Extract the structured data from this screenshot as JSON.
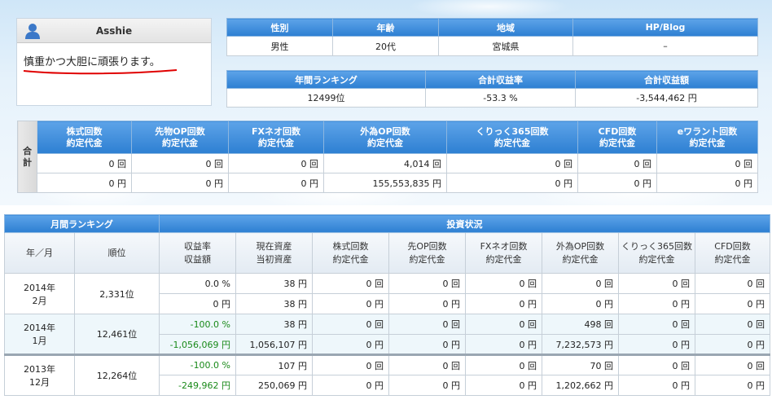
{
  "profile": {
    "name": "Asshie",
    "message": "慎重かつ大胆に頑張ります。"
  },
  "info_table": {
    "headers": [
      "性別",
      "年齢",
      "地域",
      "HP/Blog"
    ],
    "values": [
      "男性",
      "20代",
      "宮城県",
      "–"
    ]
  },
  "ranking_table": {
    "headers": [
      "年間ランキング",
      "合計収益率",
      "合計収益額"
    ],
    "values": [
      "12499位",
      "-53.3 %",
      "-3,544,462 円"
    ]
  },
  "totals_table": {
    "side_label": "合計",
    "headers": [
      [
        "株式回数",
        "約定代金"
      ],
      [
        "先物OP回数",
        "約定代金"
      ],
      [
        "FXネオ回数",
        "約定代金"
      ],
      [
        "外為OP回数",
        "約定代金"
      ],
      [
        "くりっく365回数",
        "約定代金"
      ],
      [
        "CFD回数",
        "約定代金"
      ],
      [
        "eワラント回数",
        "約定代金"
      ]
    ],
    "counts": [
      "0 回",
      "0 回",
      "0 回",
      "4,014 回",
      "0 回",
      "0 回",
      "0 回"
    ],
    "amounts": [
      "0 円",
      "0 円",
      "0 円",
      "155,553,835 円",
      "0 円",
      "0 円",
      "0 円"
    ]
  },
  "monthly_table": {
    "group_headers": [
      "月間ランキング",
      "投資状況"
    ],
    "headers": [
      [
        "年／月"
      ],
      [
        "順位"
      ],
      [
        "収益率",
        "収益額"
      ],
      [
        "現在資産",
        "当初資産"
      ],
      [
        "株式回数",
        "約定代金"
      ],
      [
        "先OP回数",
        "約定代金"
      ],
      [
        "FXネオ回数",
        "約定代金"
      ],
      [
        "外為OP回数",
        "約定代金"
      ],
      [
        "くりっく365回数",
        "約定代金"
      ],
      [
        "CFD回数",
        "約定代金"
      ]
    ],
    "rows": [
      {
        "year": "2014年",
        "month": "2月",
        "rank": "2,331位",
        "top": [
          "0.0 %",
          "38 円",
          "0 回",
          "0 回",
          "0 回",
          "0 回",
          "0 回",
          "0 回"
        ],
        "bottom": [
          "0 円",
          "38 円",
          "0 円",
          "0 円",
          "0 円",
          "0 円",
          "0 円",
          "0 円"
        ]
      },
      {
        "year": "2014年",
        "month": "1月",
        "rank": "12,461位",
        "top": [
          "-100.0 %",
          "38 円",
          "0 回",
          "0 回",
          "0 回",
          "498 回",
          "0 回",
          "0 回"
        ],
        "bottom": [
          "-1,056,069 円",
          "1,056,107 円",
          "0 円",
          "0 円",
          "0 円",
          "7,232,573 円",
          "0 円",
          "0 円"
        ]
      },
      {
        "year": "2013年",
        "month": "12月",
        "rank": "12,264位",
        "top": [
          "-100.0 %",
          "107 円",
          "0 回",
          "0 回",
          "0 回",
          "70 回",
          "0 回",
          "0 回"
        ],
        "bottom": [
          "-249,962 円",
          "250,069 円",
          "0 円",
          "0 円",
          "0 円",
          "1,202,662 円",
          "0 円",
          "0 円"
        ]
      }
    ]
  }
}
